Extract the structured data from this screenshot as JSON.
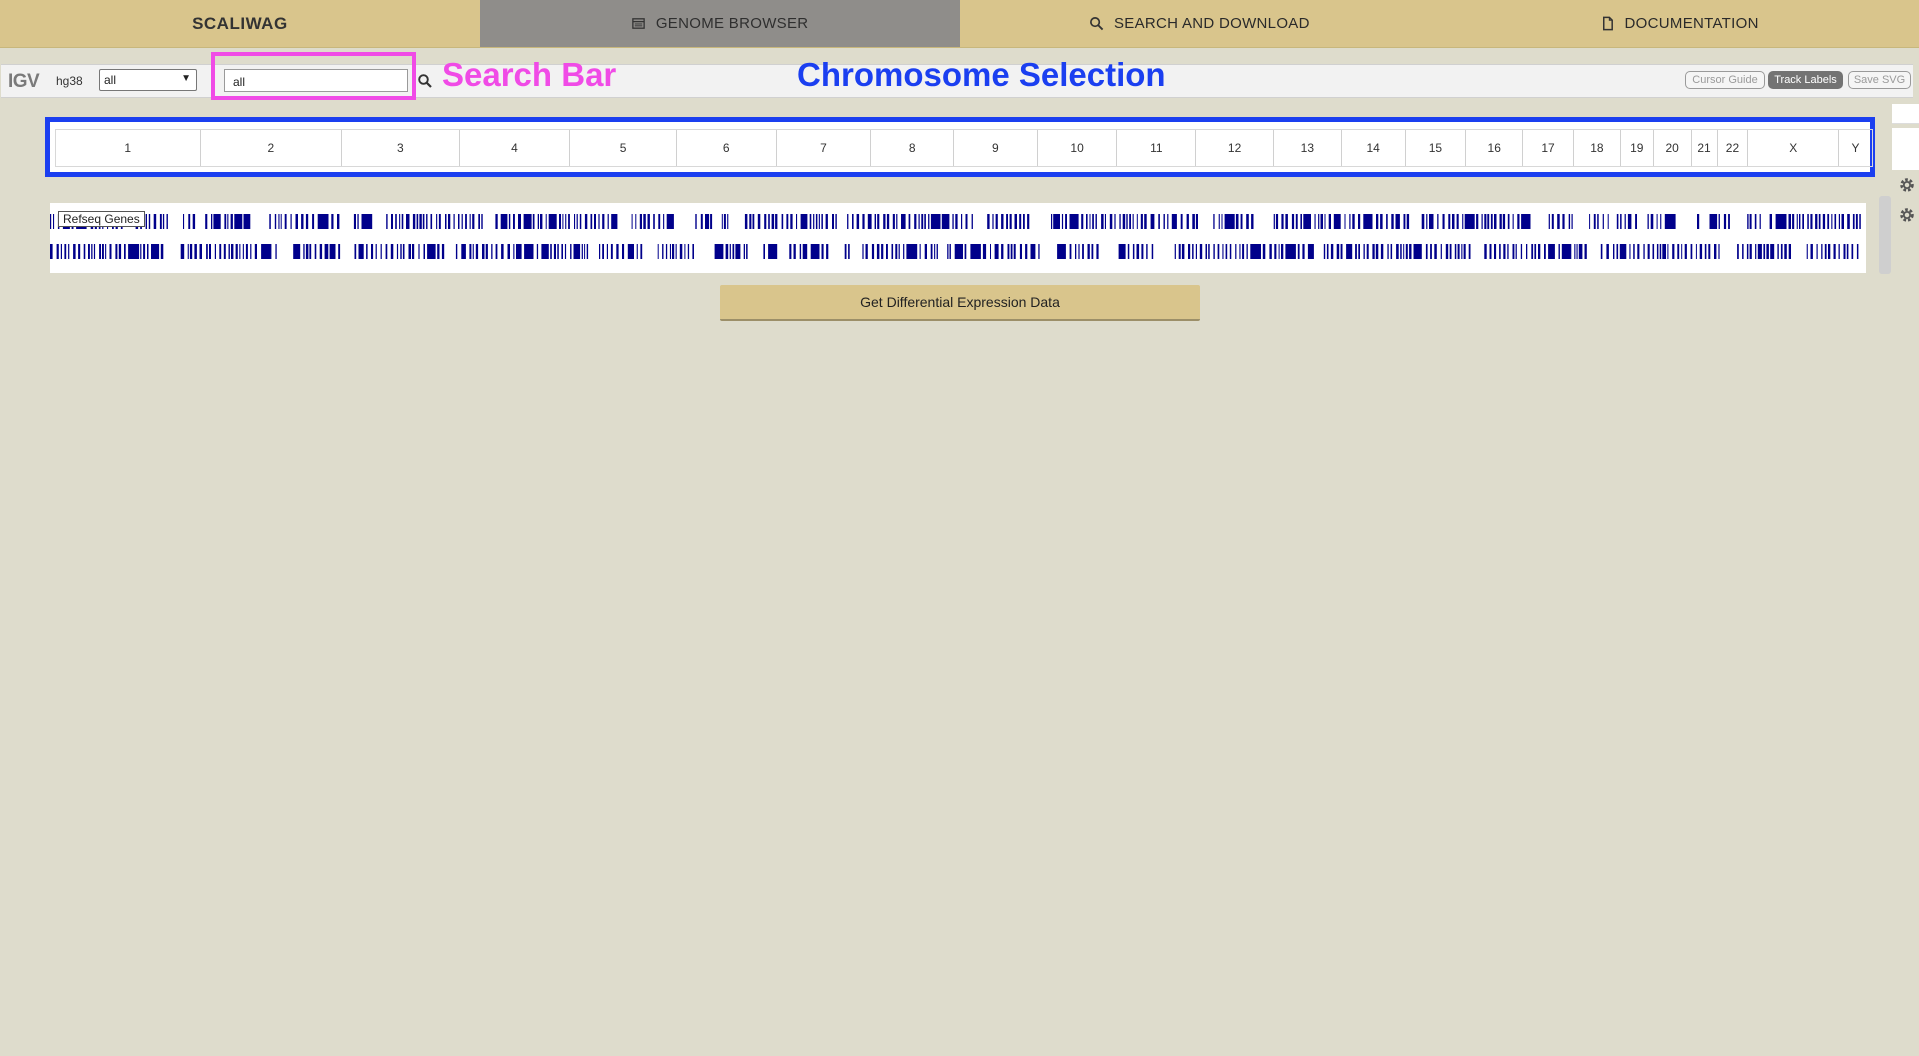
{
  "nav": {
    "brand": "SCALIWAG",
    "items": [
      {
        "label": "GENOME BROWSER",
        "icon": "browser-window-icon"
      },
      {
        "label": "SEARCH AND DOWNLOAD",
        "icon": "search-icon"
      },
      {
        "label": "DOCUMENTATION",
        "icon": "document-icon"
      }
    ]
  },
  "igv": {
    "logo": "IGV",
    "genome": "hg38",
    "chromosome_select": "all",
    "search_value": "all",
    "buttons": {
      "cursor_guide": "Cursor Guide",
      "track_labels": "Track Labels",
      "save_svg": "Save SVG"
    }
  },
  "annotations": {
    "search_bar": "Search Bar",
    "chromosome_selection": "Chromosome Selection",
    "search_color": "#f04be6",
    "chromosome_color": "#1b3ff0"
  },
  "chromosomes": [
    "1",
    "2",
    "3",
    "4",
    "5",
    "6",
    "7",
    "8",
    "9",
    "10",
    "11",
    "12",
    "13",
    "14",
    "15",
    "16",
    "17",
    "18",
    "19",
    "20",
    "21",
    "22",
    "X",
    "Y"
  ],
  "tracks": {
    "refseq_label": "Refseq Genes",
    "feature_color": "#00008b"
  },
  "actions": {
    "differential_expression": "Get Differential Expression Data"
  }
}
